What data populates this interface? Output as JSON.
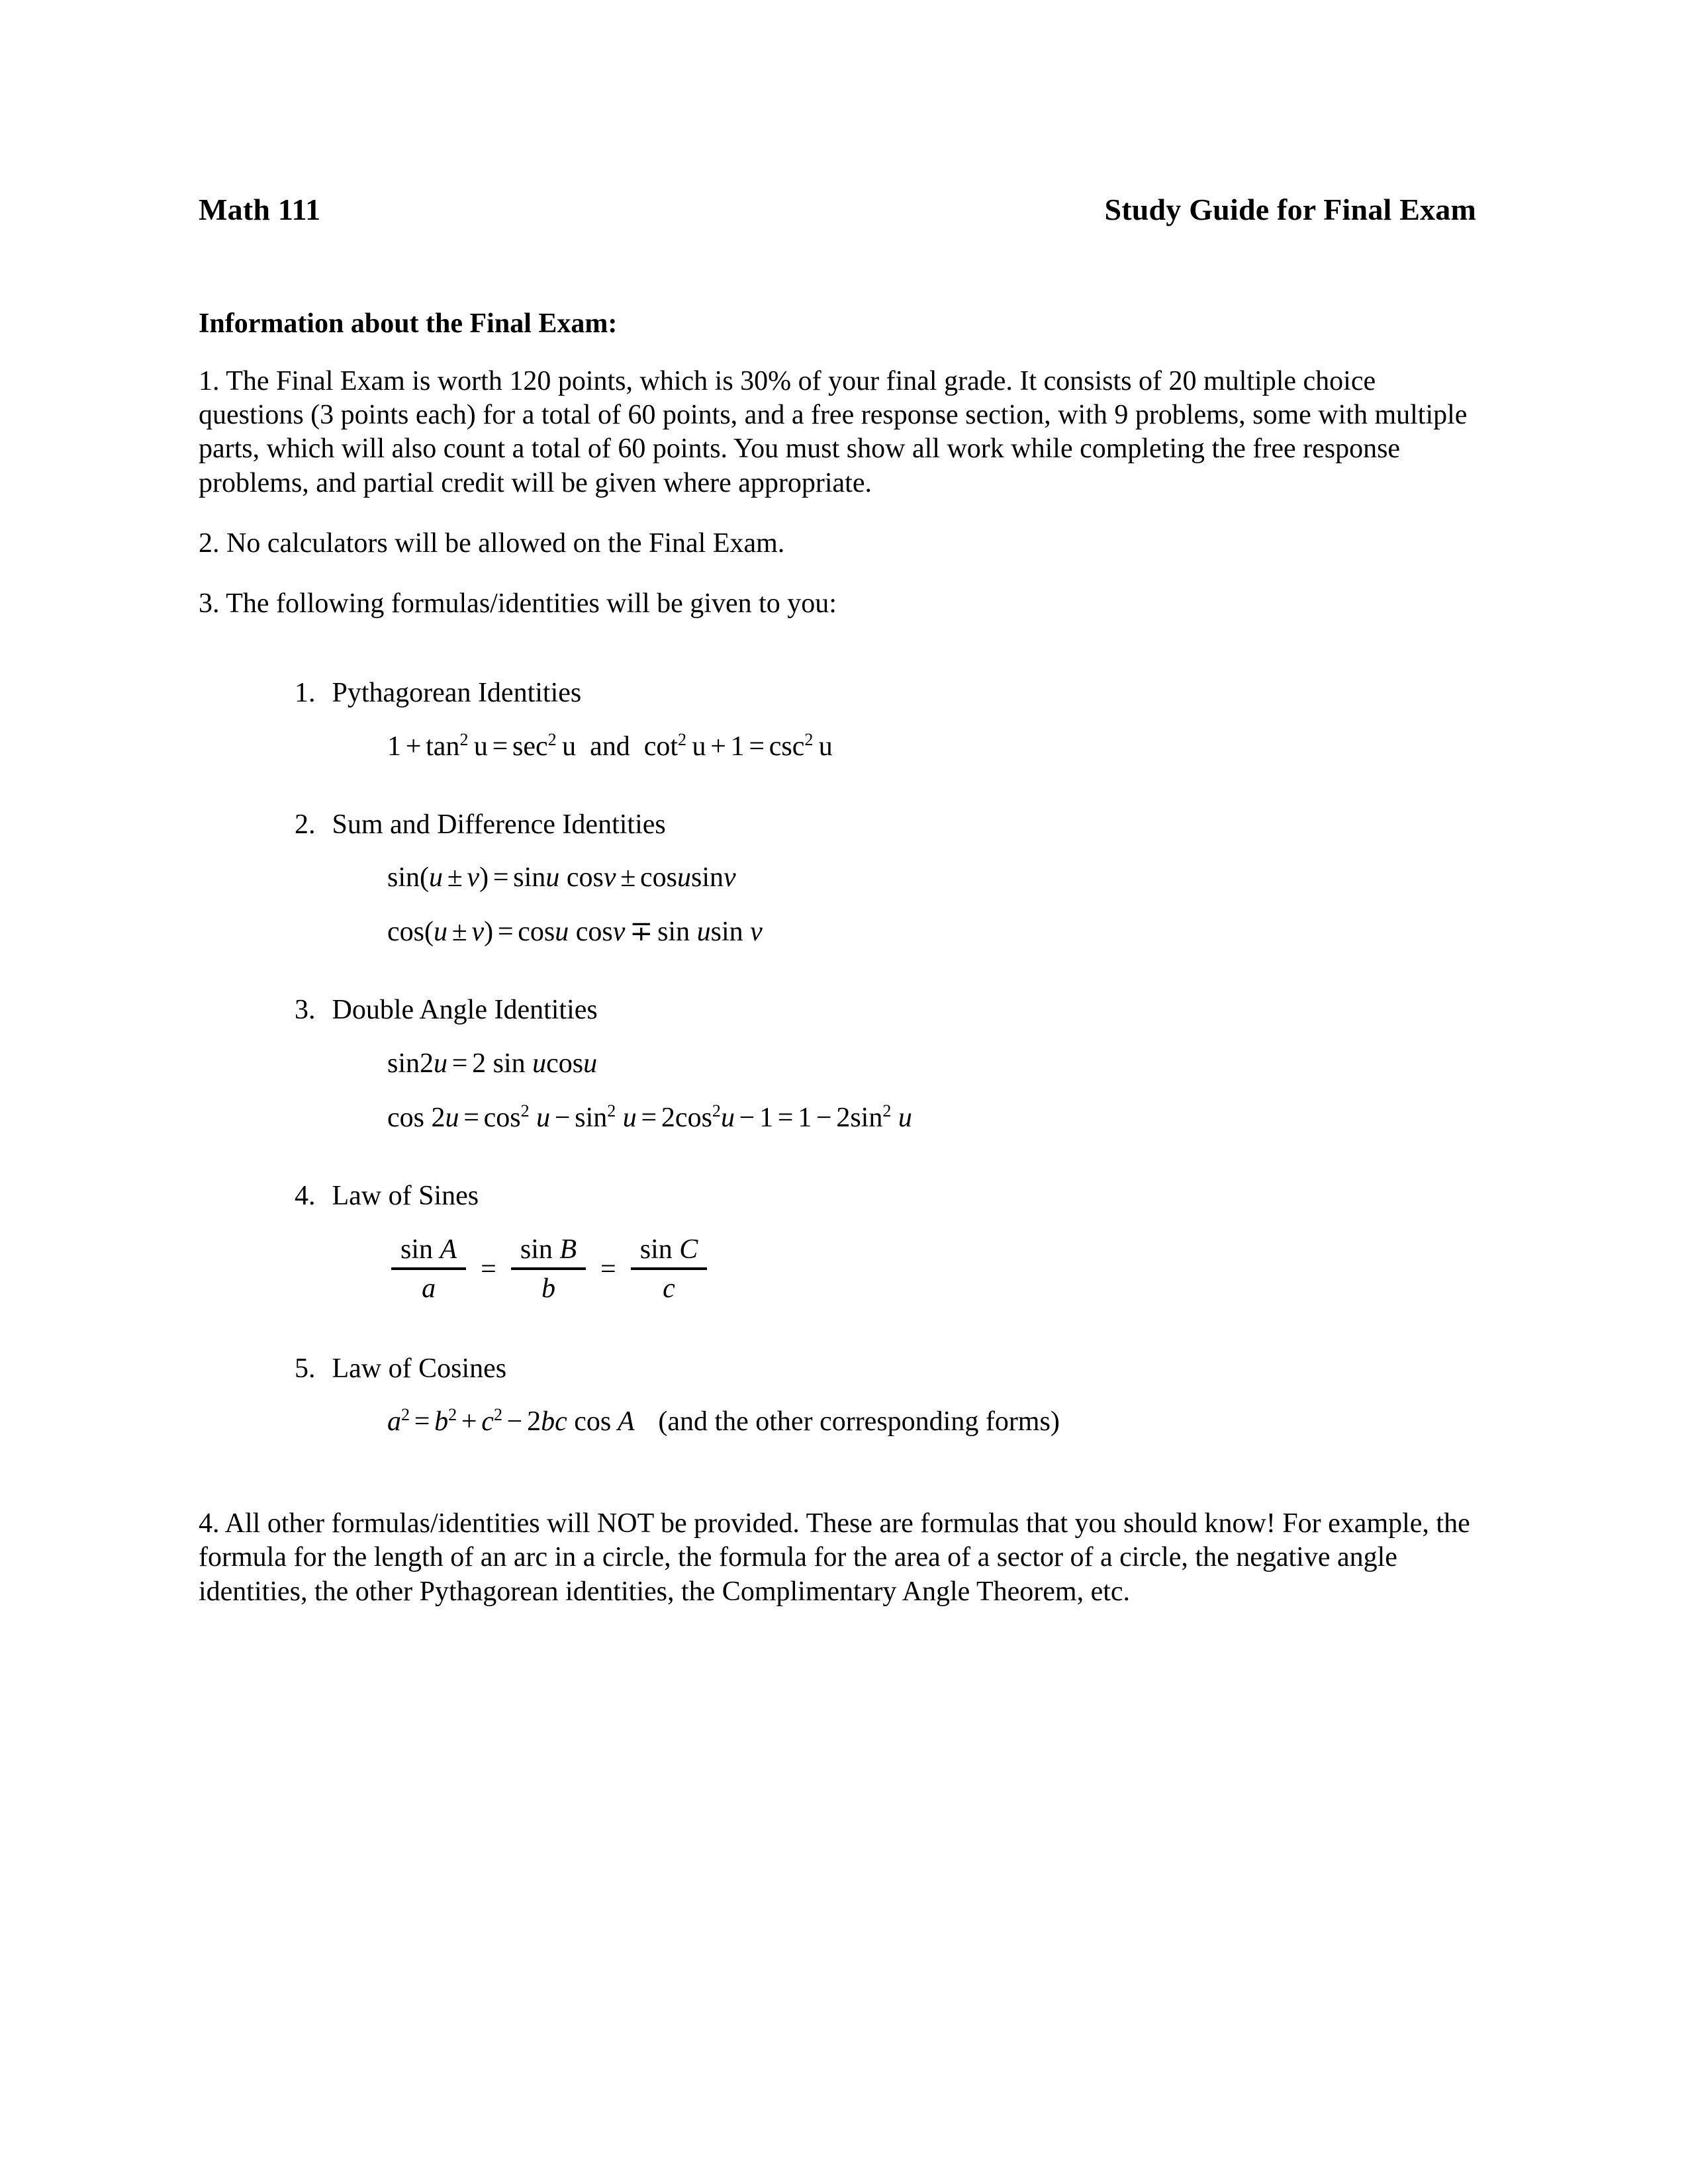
{
  "header": {
    "course": "Math 111",
    "title": "Study Guide for Final Exam"
  },
  "section_heading": "Information about the Final Exam:",
  "paragraphs": [
    {
      "number": "1.",
      "text": "1.  The Final Exam is worth 120 points, which is 30% of your final grade.  It consists of 20 multiple choice questions (3 points each) for a total of 60 points, and a free response section, with 9 problems, some with multiple parts, which will also count a total of 60 points.  You must show all work while completing the free response problems, and partial credit will be given where appropriate."
    },
    {
      "number": "2.",
      "text": "2.  No calculators will be allowed on the Final Exam."
    },
    {
      "number": "3.",
      "text": "3.  The following formulas/identities will be given to you:"
    }
  ],
  "identities": [
    {
      "number": "1.",
      "label": "Pythagorean Identities",
      "formulas": [
        {
          "plain": "1 + tan² u = sec² u   and   cot² u + 1 = csc² u",
          "parts": [
            {
              "t": "1",
              "s": "r"
            },
            {
              "t": "+",
              "s": "op"
            },
            {
              "t": "tan",
              "s": "r"
            },
            {
              "t": "2",
              "s": "sup"
            },
            {
              "t": " u",
              "s": "r"
            },
            {
              "t": "=",
              "s": "op"
            },
            {
              "t": "sec",
              "s": "r"
            },
            {
              "t": "2",
              "s": "sup"
            },
            {
              "t": " u",
              "s": "r"
            },
            {
              "t": "and",
              "s": "word"
            },
            {
              "t": "cot",
              "s": "r"
            },
            {
              "t": "2",
              "s": "sup"
            },
            {
              "t": " u",
              "s": "r"
            },
            {
              "t": "+",
              "s": "op"
            },
            {
              "t": "1",
              "s": "r"
            },
            {
              "t": "=",
              "s": "op"
            },
            {
              "t": "csc",
              "s": "r"
            },
            {
              "t": "2",
              "s": "sup"
            },
            {
              "t": " u",
              "s": "r"
            }
          ]
        }
      ]
    },
    {
      "number": "2.",
      "label": "Sum and Difference Identities",
      "formulas": [
        {
          "plain": "sin(u ± v) = sin u cos v ± cos u sin v",
          "parts": [
            {
              "t": "sin",
              "s": "r"
            },
            {
              "t": "(",
              "s": "paren"
            },
            {
              "t": "u",
              "s": "i"
            },
            {
              "t": "±",
              "s": "op"
            },
            {
              "t": "v",
              "s": "i"
            },
            {
              "t": ")",
              "s": "paren"
            },
            {
              "t": "=",
              "s": "op"
            },
            {
              "t": "sin",
              "s": "r"
            },
            {
              "t": "u",
              "s": "i"
            },
            {
              "t": " cos",
              "s": "r"
            },
            {
              "t": "v",
              "s": "i"
            },
            {
              "t": "±",
              "s": "op"
            },
            {
              "t": "cos",
              "s": "r"
            },
            {
              "t": "u",
              "s": "i"
            },
            {
              "t": "sin",
              "s": "r"
            },
            {
              "t": "v",
              "s": "i"
            }
          ]
        },
        {
          "plain": "cos(u ± v) = cos u cos v ∓ sin u sin v",
          "parts": [
            {
              "t": "cos",
              "s": "r"
            },
            {
              "t": "(",
              "s": "paren"
            },
            {
              "t": "u",
              "s": "i"
            },
            {
              "t": "±",
              "s": "op"
            },
            {
              "t": "v",
              "s": "i"
            },
            {
              "t": ")",
              "s": "paren"
            },
            {
              "t": "=",
              "s": "op"
            },
            {
              "t": "cos",
              "s": "r"
            },
            {
              "t": "u",
              "s": "i"
            },
            {
              "t": " cos",
              "s": "r"
            },
            {
              "t": "v",
              "s": "i"
            },
            {
              "t": "∓",
              "s": "op"
            },
            {
              "t": "sin",
              "s": "r"
            },
            {
              "t": " u",
              "s": "i"
            },
            {
              "t": "sin",
              "s": "r"
            },
            {
              "t": " v",
              "s": "i"
            }
          ]
        }
      ]
    },
    {
      "number": "3.",
      "label": "Double Angle Identities",
      "formulas": [
        {
          "plain": "sin 2u = 2 sin u cos u",
          "parts": [
            {
              "t": "sin",
              "s": "r"
            },
            {
              "t": "2",
              "s": "r"
            },
            {
              "t": "u",
              "s": "i"
            },
            {
              "t": "=",
              "s": "op"
            },
            {
              "t": "2",
              "s": "r"
            },
            {
              "t": " sin",
              "s": "r"
            },
            {
              "t": " u",
              "s": "i"
            },
            {
              "t": "cos",
              "s": "r"
            },
            {
              "t": "u",
              "s": "i"
            }
          ]
        },
        {
          "plain": "cos 2u = cos² u − sin² u = 2cos² u − 1 = 1 − 2sin² u",
          "parts": [
            {
              "t": "cos",
              "s": "r"
            },
            {
              "t": " 2",
              "s": "r"
            },
            {
              "t": "u",
              "s": "i"
            },
            {
              "t": "=",
              "s": "op"
            },
            {
              "t": "cos",
              "s": "r"
            },
            {
              "t": "2",
              "s": "sup"
            },
            {
              "t": " u",
              "s": "i"
            },
            {
              "t": "−",
              "s": "op"
            },
            {
              "t": "sin",
              "s": "r"
            },
            {
              "t": "2",
              "s": "sup"
            },
            {
              "t": " u",
              "s": "i"
            },
            {
              "t": "=",
              "s": "op"
            },
            {
              "t": "2cos",
              "s": "r"
            },
            {
              "t": "2",
              "s": "sup"
            },
            {
              "t": "u",
              "s": "i"
            },
            {
              "t": "−",
              "s": "op"
            },
            {
              "t": "1",
              "s": "r"
            },
            {
              "t": "=",
              "s": "op"
            },
            {
              "t": "1",
              "s": "r"
            },
            {
              "t": "−",
              "s": "op"
            },
            {
              "t": "2",
              "s": "r"
            },
            {
              "t": "sin",
              "s": "r"
            },
            {
              "t": "2",
              "s": "sup"
            },
            {
              "t": " u",
              "s": "i"
            }
          ]
        }
      ]
    },
    {
      "number": "4.",
      "label": "Law of Sines",
      "fraction_equation": {
        "plain": "sin A / a = sin B / b = sin C / c",
        "terms": [
          {
            "numer_fn": "sin",
            "numer_var": "A",
            "denom": "a"
          },
          {
            "numer_fn": "sin",
            "numer_var": "B",
            "denom": "b"
          },
          {
            "numer_fn": "sin",
            "numer_var": "C",
            "denom": "c"
          }
        ],
        "separator": "="
      }
    },
    {
      "number": "5.",
      "label": "Law of Cosines",
      "formulas": [
        {
          "plain": "a² = b² + c² − 2bc cos A  (and the other corresponding forms)",
          "parts": [
            {
              "t": "a",
              "s": "i"
            },
            {
              "t": "2",
              "s": "sup"
            },
            {
              "t": "=",
              "s": "op"
            },
            {
              "t": "b",
              "s": "i"
            },
            {
              "t": "2",
              "s": "sup"
            },
            {
              "t": "+",
              "s": "op"
            },
            {
              "t": "c",
              "s": "i"
            },
            {
              "t": "2",
              "s": "sup"
            },
            {
              "t": "−",
              "s": "op"
            },
            {
              "t": "2",
              "s": "r"
            },
            {
              "t": "bc",
              "s": "i"
            },
            {
              "t": " cos",
              "s": "r"
            },
            {
              "t": " A",
              "s": "i"
            }
          ],
          "trailing_note": "(and the other corresponding forms)"
        }
      ]
    }
  ],
  "final_paragraph": {
    "number": "4.",
    "text": "4.  All other formulas/identities will NOT be provided.  These are formulas that you should know!  For example, the formula for the length of an arc in a circle, the formula for the area of a sector of a circle, the negative angle identities, the other Pythagorean identities, the Complimentary Angle Theorem, etc."
  }
}
